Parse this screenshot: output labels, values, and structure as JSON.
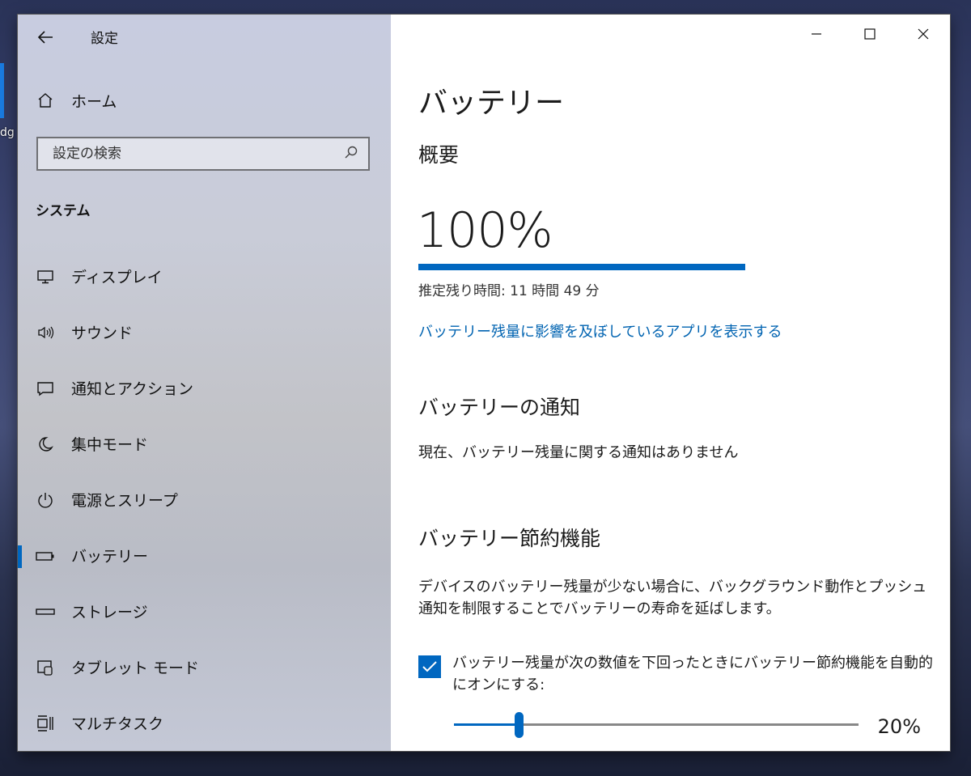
{
  "window": {
    "title": "設定"
  },
  "sidebar": {
    "home_label": "ホーム",
    "search_placeholder": "設定の検索",
    "section_label": "システム",
    "items": [
      {
        "label": "ディスプレイ",
        "icon": "monitor-icon",
        "selected": false
      },
      {
        "label": "サウンド",
        "icon": "speaker-icon",
        "selected": false
      },
      {
        "label": "通知とアクション",
        "icon": "notification-icon",
        "selected": false
      },
      {
        "label": "集中モード",
        "icon": "moon-icon",
        "selected": false
      },
      {
        "label": "電源とスリープ",
        "icon": "power-icon",
        "selected": false
      },
      {
        "label": "バッテリー",
        "icon": "battery-icon",
        "selected": true
      },
      {
        "label": "ストレージ",
        "icon": "storage-icon",
        "selected": false
      },
      {
        "label": "タブレット モード",
        "icon": "tablet-icon",
        "selected": false
      },
      {
        "label": "マルチタスク",
        "icon": "multitask-icon",
        "selected": false
      }
    ]
  },
  "main": {
    "title": "バッテリー",
    "overview_heading": "概要",
    "percent": "100%",
    "percent_fraction": 1.0,
    "estimate": "推定残り時間: 11 時間 49 分",
    "apps_link": "バッテリー残量に影響を及ぼしているアプリを表示する",
    "notify_heading": "バッテリーの通知",
    "notify_text": "現在、バッテリー残量に関する通知はありません",
    "saver_heading": "バッテリー節約機能",
    "saver_desc": "デバイスのバッテリー残量が少ない場合に、バックグラウンド動作とプッシュ通知を制限することでバッテリーの寿命を延ばします。",
    "auto_checkbox_label": "バッテリー残量が次の数値を下回ったときにバッテリー節約機能を自動的にオンにする:",
    "auto_checked": true,
    "threshold_label": "20%",
    "threshold_fraction": 0.16
  },
  "desktop": {
    "label_fragment": "dg"
  },
  "colors": {
    "accent": "#0067c0",
    "link": "#0063b1"
  }
}
